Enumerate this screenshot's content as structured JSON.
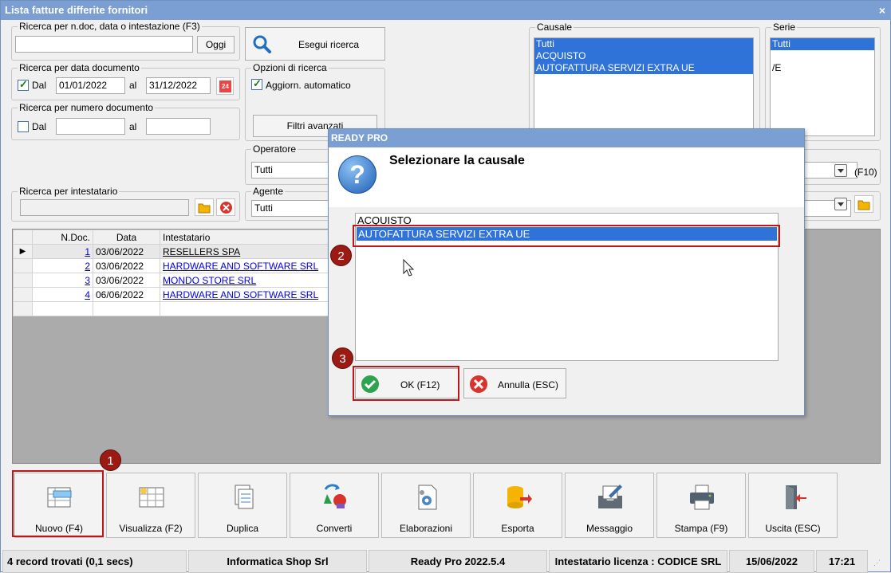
{
  "window": {
    "title": "Lista fatture differite fornitori",
    "close_label": "×"
  },
  "search_doc": {
    "legend": "Ricerca per n.doc, data o intestazione (F3)",
    "value": "",
    "ok_label": "Oggi"
  },
  "run_search": {
    "label": "Esegui ricerca"
  },
  "date_search": {
    "legend": "Ricerca per data documento",
    "from_label": "Dal",
    "from": "01/01/2022",
    "to_label": "al",
    "to": "31/12/2022",
    "calendar_text": "24"
  },
  "num_search": {
    "legend": "Ricerca per numero documento",
    "from_label": "Dal",
    "to_label": "al",
    "from": "",
    "to": ""
  },
  "options": {
    "legend": "Opzioni di ricerca",
    "auto_update": "Aggiorn. automatico",
    "advanced_filters": "Filtri avanzati"
  },
  "causale": {
    "legend": "Causale",
    "items": [
      "Tutti",
      "ACQUISTO",
      "AUTOFATTURA SERVIZI EXTRA UE"
    ]
  },
  "serie": {
    "legend": "Serie",
    "items": [
      "Tutti",
      "",
      "/E"
    ]
  },
  "operatore": {
    "legend": "Operatore",
    "value": "Tutti",
    "shortcut": "(F10)"
  },
  "agente": {
    "legend": "Agente",
    "value": "Tutti"
  },
  "intestatario": {
    "legend": "Ricerca per intestatario",
    "value": ""
  },
  "grid": {
    "headers": [
      "N.Doc.",
      "Data",
      "Intestatario"
    ],
    "rows": [
      {
        "num": "1",
        "date": "03/06/2022",
        "name": "RESELLERS SPA"
      },
      {
        "num": "2",
        "date": "03/06/2022",
        "name": "HARDWARE AND SOFTWARE SRL"
      },
      {
        "num": "3",
        "date": "03/06/2022",
        "name": "MONDO STORE SRL"
      },
      {
        "num": "4",
        "date": "06/06/2022",
        "name": "HARDWARE AND SOFTWARE SRL"
      }
    ]
  },
  "toolbar": {
    "nuovo": "Nuovo (F4)",
    "visualizza": "Visualizza (F2)",
    "duplica": "Duplica",
    "converti": "Converti",
    "elaborazioni": "Elaborazioni",
    "esporta": "Esporta",
    "messaggio": "Messaggio",
    "stampa": "Stampa (F9)",
    "uscita": "Uscita (ESC)"
  },
  "status": {
    "records": "4 record trovati (0,1 secs)",
    "company": "Informatica Shop Srl",
    "version": "Ready Pro 2022.5.4",
    "license": "Intestatario licenza : CODICE SRL",
    "date": "15/06/2022",
    "time": "17:21"
  },
  "dialog": {
    "title": "READY PRO",
    "question_mark": "?",
    "message": "Selezionare la causale",
    "options": [
      "ACQUISTO",
      "AUTOFATTURA SERVIZI EXTRA UE"
    ],
    "ok_label": "OK (F12)",
    "cancel_label": "Annulla (ESC)"
  },
  "callouts": [
    "1",
    "2",
    "3"
  ],
  "colors": {
    "title_bar": "#7b9ed3",
    "selection": "#3073d8",
    "callout": "#9c1a14",
    "highlight_box": "#c0161b"
  }
}
